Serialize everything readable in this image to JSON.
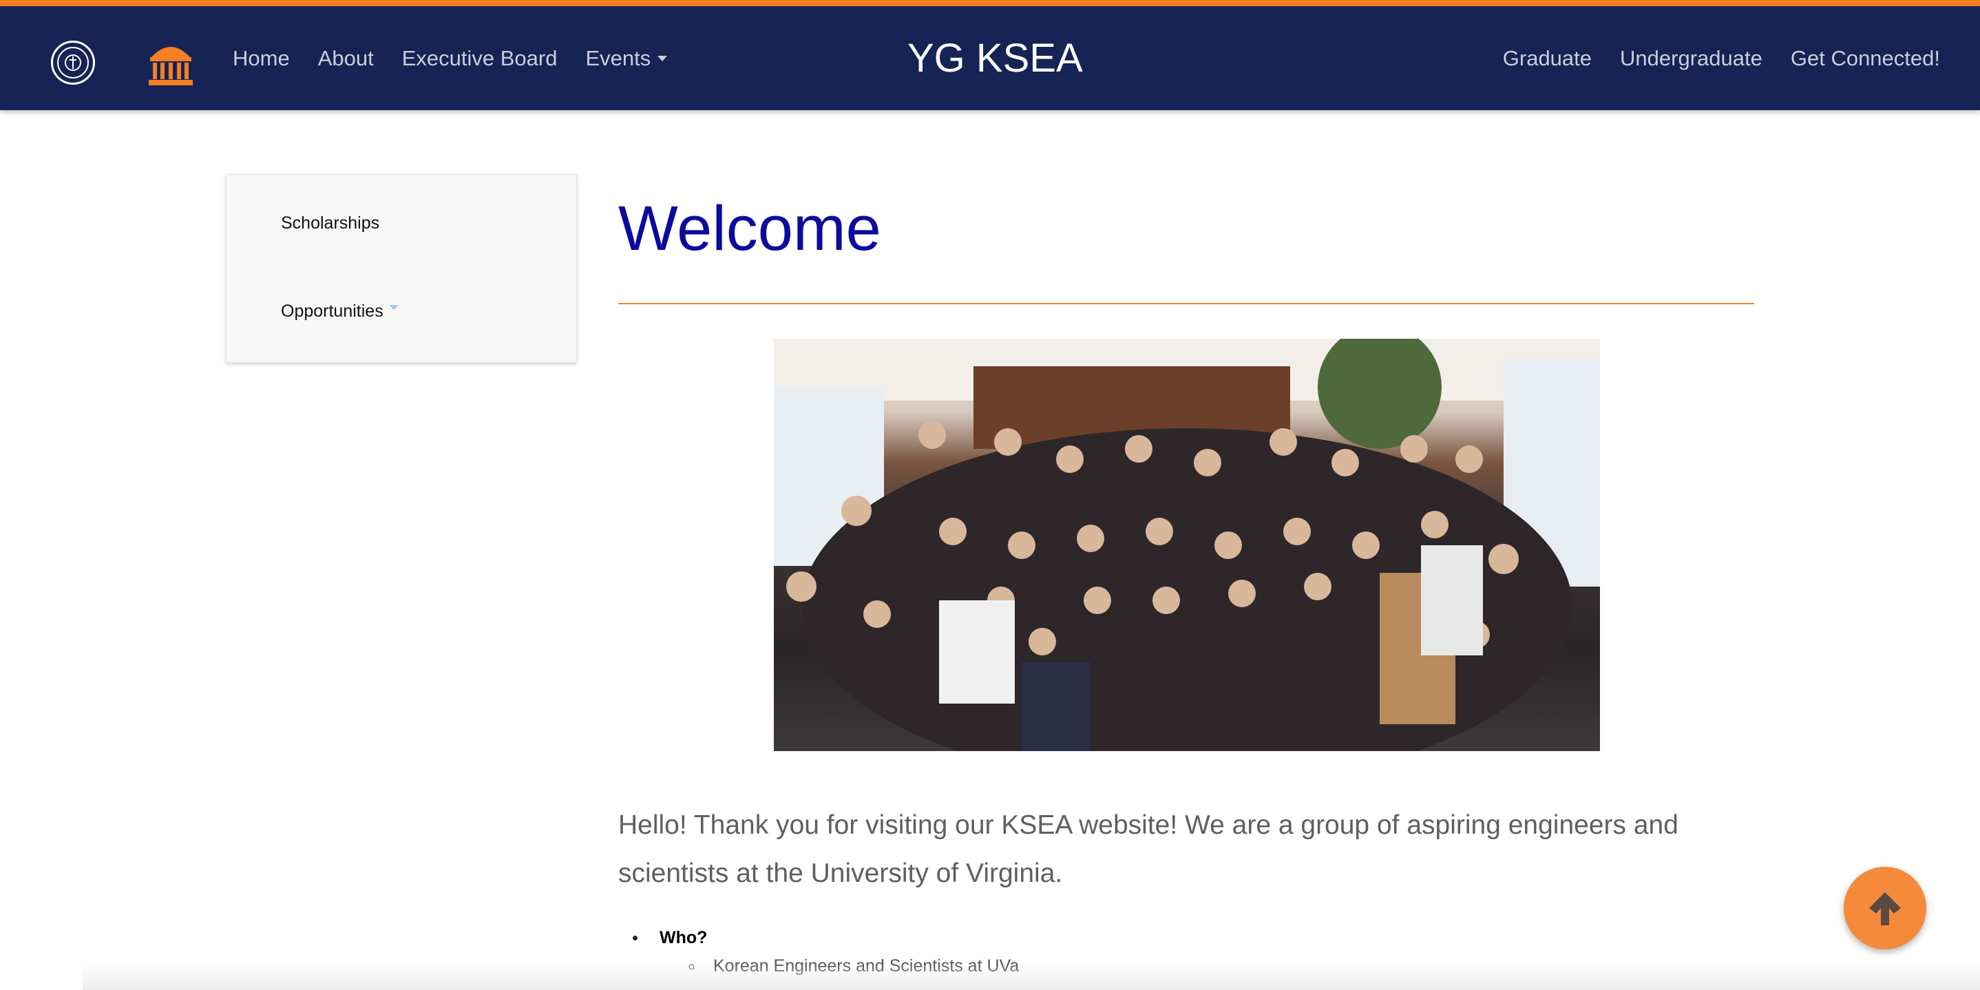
{
  "colors": {
    "navbar_bg": "#152355",
    "accent_orange": "#f57f22",
    "title_blue": "#0d0a9e",
    "to_top_button": "#f58a3a"
  },
  "navbar": {
    "brand": "YG KSEA",
    "left_links": [
      "Home",
      "About",
      "Executive Board",
      "Events"
    ],
    "right_links": [
      "Graduate",
      "Undergraduate",
      "Get Connected!"
    ],
    "icons": [
      "ksea-seal-icon",
      "uva-rotunda-icon",
      "chevron-down-icon"
    ]
  },
  "sidebar": {
    "items": [
      {
        "label": "Scholarships"
      },
      {
        "label": "Opportunities"
      }
    ]
  },
  "main": {
    "title": "Welcome",
    "intro": "Hello! Thank you for visiting our KSEA website! We are a group of aspiring engineers and scientists at the University of Virginia.",
    "list": {
      "heading": "Who?",
      "items": [
        "Korean Engineers and Scientists at UVa"
      ]
    }
  },
  "back_to_top": {
    "icon": "arrow-up-icon"
  }
}
